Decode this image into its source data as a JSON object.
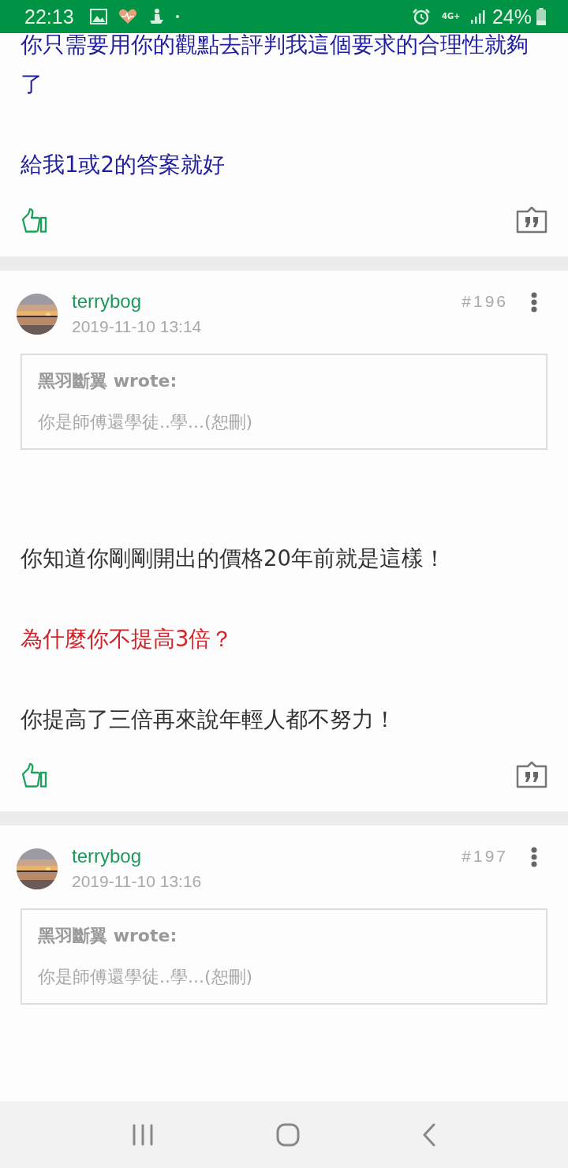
{
  "status_bar": {
    "time": "22:13",
    "battery": "24%",
    "network": "4G+"
  },
  "posts": [
    {
      "kind": "partial",
      "body": [
        {
          "text": "你只需要用你的觀點去評判我這個要求的合理性就夠了",
          "color": "#1f1f9e"
        },
        {
          "text": "給我1或2的答案就好",
          "color": "#1f1f9e"
        }
      ]
    },
    {
      "kind": "full",
      "author": "terrybog",
      "date": "2019-11-10 13:14",
      "number": "#196",
      "quote": {
        "author": "黑羽斷翼 wrote:",
        "text": "你是師傅還學徒..學...(恕刪)"
      },
      "body": [
        {
          "text": "你知道你剛剛開出的價格20年前就是這樣！",
          "color": "#333333"
        },
        {
          "text": "為什麼你不提高3倍？",
          "color": "#d0262b"
        },
        {
          "text": "你提高了三倍再來說年輕人都不努力！",
          "color": "#333333"
        }
      ]
    },
    {
      "kind": "full",
      "author": "terrybog",
      "date": "2019-11-10 13:16",
      "number": "#197",
      "quote": {
        "author": "黑羽斷翼 wrote:",
        "text": "你是師傅還學徒..學...(恕刪)"
      }
    }
  ]
}
